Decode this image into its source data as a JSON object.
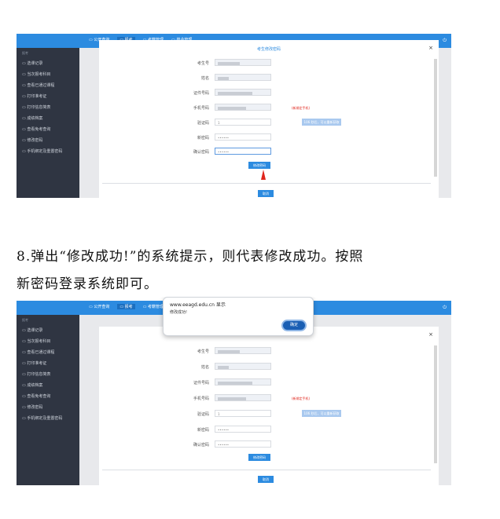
{
  "app": {
    "nav": [
      "公开查询",
      "报考",
      "考籍管理",
      "毕业管理"
    ],
    "sidebar_section": "报考",
    "sidebar_items": [
      "选课记录",
      "当次报考科目",
      "查看已通过课程",
      "打印准考证",
      "打印信息简表",
      "成绩档案",
      "查看免考查询",
      "修改密码",
      "手机绑定及重置密码"
    ]
  },
  "form": {
    "title": "考生修改密码",
    "labels": [
      "考生号",
      "姓名",
      "证件号码",
      "手机号码",
      "验证码",
      "新密码",
      "确认密码"
    ],
    "phone_note": "(新绑定手机)",
    "sms_button": "106 秒后，可以重新获取",
    "code_value": "1",
    "password_mask": "••••••",
    "submit": "修改密码",
    "cancel": "取消",
    "close": "×"
  },
  "step_text": {
    "line1": "8.弹出“修改成功!”的系统提示，则代表修改成功。按照",
    "line2": "新密码登录系统即可。"
  },
  "alert": {
    "host": "www.eeagd.edu.cn 显示",
    "message": "修改成功!",
    "ok": "确定"
  }
}
